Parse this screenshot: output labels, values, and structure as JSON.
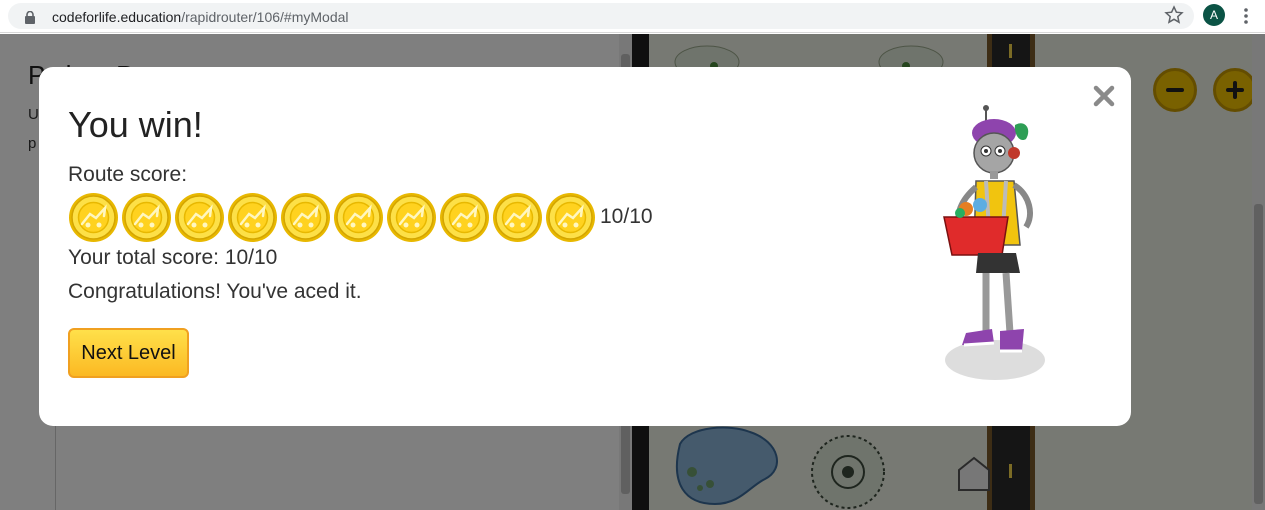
{
  "browser": {
    "url_domain": "codeforlife.education",
    "url_path": "/rapidrouter/106/#myModal",
    "avatar_letter": "A",
    "icons": [
      "lock-icon",
      "star-icon",
      "kebab-menu-icon"
    ]
  },
  "background_page": {
    "title_partial": "Python Pr",
    "text_line_1": "U",
    "text_line_2": "p"
  },
  "modal": {
    "title": "You win!",
    "route_score_label": "Route score:",
    "coin_count": 10,
    "route_score": "10/10",
    "total_score_text": "Your total score: 10/10",
    "message": "Congratulations! You've aced it.",
    "next_level_label": "Next Level",
    "close_icon": "close-icon",
    "coin_icon": "gold-coin-icon",
    "character_image": "robot-character-with-basket"
  },
  "colors": {
    "button_yellow": "#fbb923",
    "button_border": "#f0a020",
    "coin_gold": "#f5c518",
    "overlay": "rgba(0,0,0,0.5)",
    "avatar_green": "#0b5345"
  }
}
